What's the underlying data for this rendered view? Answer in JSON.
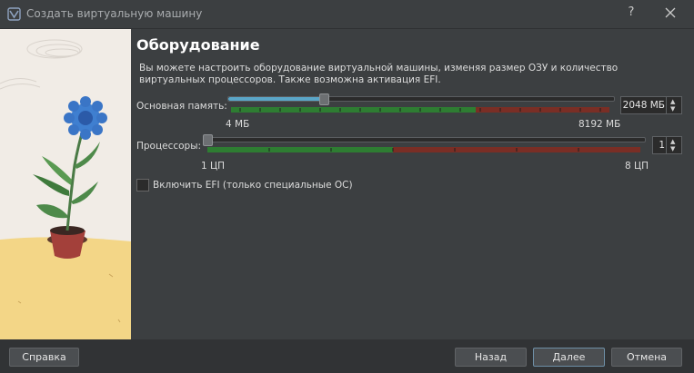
{
  "window": {
    "title": "Создать виртуальную машину",
    "help_label": "?"
  },
  "page": {
    "heading": "Оборудование",
    "description": "Вы можете настроить оборудование виртуальной машины, изменяя размер ОЗУ и количество виртуальных процессоров. Также возможна активация EFI."
  },
  "memory": {
    "label": "Основная память:",
    "value": "2048 МБ",
    "value_mb": 2048,
    "min_label": "4 МБ",
    "max_label": "8192 МБ",
    "min_mb": 4,
    "max_mb": 8192
  },
  "cpu": {
    "label": "Процессоры:",
    "value": "1",
    "value_count": 1,
    "min_label": "1 ЦП",
    "max_label": "8 ЦП",
    "min_count": 1,
    "max_count": 8
  },
  "efi": {
    "label": "Включить EFI (только специальные ОС)",
    "checked": false
  },
  "buttons": {
    "help": "Справка",
    "back": "Назад",
    "next": "Далее",
    "cancel": "Отмена"
  },
  "colors": {
    "background": "#3c3f41",
    "scale_green": "#2e7d32",
    "scale_red": "#7a2e25",
    "slider_fill": "#5aa6c8"
  }
}
